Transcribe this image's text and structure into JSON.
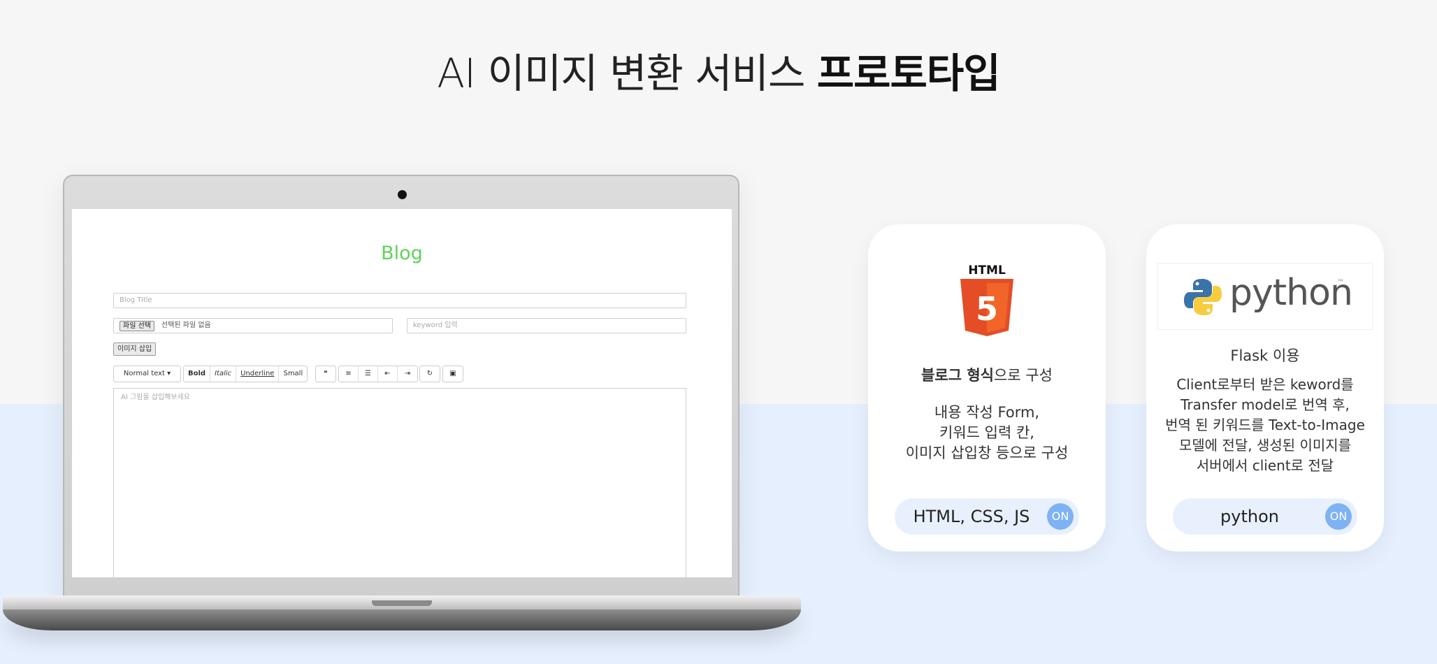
{
  "title": {
    "light": "AI 이미지 변환 서비스 ",
    "bold": "프로토타입"
  },
  "blog": {
    "heading": "Blog",
    "title_placeholder": "Blog Title",
    "file_button": "파일 선택",
    "file_status": "선택된 파일 없음",
    "keyword_placeholder": "keyword 입력",
    "insert_button": "이미지 삽입",
    "toolbar": {
      "style": "Normal text ▾",
      "bold": "Bold",
      "italic": "Italic",
      "underline": "Underline",
      "small": "Small",
      "quote": "❝",
      "ordered_list": "≡",
      "unordered_list": "☰",
      "outdent": "⇤",
      "indent": "⇥",
      "redo": "↻",
      "image": "▣"
    },
    "editor_placeholder": "AI 그림을 삽입해보세요"
  },
  "cards": [
    {
      "logo_text": "HTML",
      "logo_number": "5",
      "heading_bold": "블로그 형식",
      "heading_rest": "으로 구성",
      "lines": [
        "내용 작성 Form,",
        "키워드 입력 칸,",
        "이미지 삽입창 등으로 구성"
      ],
      "pill_label": "HTML, CSS, JS",
      "pill_status": "ON"
    },
    {
      "logo_text": "python",
      "logo_tm": "™",
      "heading_bold": "Flask",
      "heading_rest": " 이용",
      "lines": [
        "Client로부터 받은 keword를",
        "Transfer model로 번역 후,",
        "번역 된 키워드를 Text-to-Image",
        "모델에 전달, 생성된 이미지를",
        "서버에서 client로 전달"
      ],
      "pill_label": "python",
      "pill_status": "ON"
    }
  ],
  "colors": {
    "blog_heading": "#5fd35a",
    "pill_bg": "#e8f0fd",
    "on_badge": "#7eb2f4",
    "html5_orange": "#e44d26",
    "bottom_band": "#e6effd"
  }
}
